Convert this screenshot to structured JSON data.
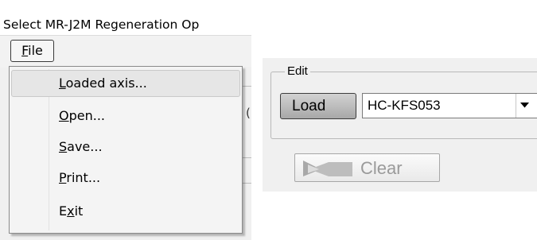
{
  "window": {
    "title": "Select MR-J2M Regeneration Op"
  },
  "menubar": {
    "file_label_accel": "F",
    "file_label_rest": "ile"
  },
  "file_menu": {
    "items": [
      {
        "accel": "L",
        "rest": "oaded axis...",
        "highlighted": true
      },
      {
        "accel": "O",
        "rest": "pen...",
        "highlighted": false
      },
      {
        "accel": "S",
        "rest": "ave...",
        "highlighted": false
      },
      {
        "accel": "P",
        "rest": "rint...",
        "highlighted": false
      },
      {
        "pre": "E",
        "accel": "x",
        "rest": "it",
        "highlighted": false
      }
    ]
  },
  "edit_group": {
    "title": "Edit",
    "load_label": "Load",
    "model_value": "HC-KFS053",
    "clear_label": "Clear"
  },
  "icons": {
    "combo_arrow": "chevron-down-icon",
    "clear_icon": "eraser-icon"
  },
  "colors": {
    "window_bg": "#f0f0f0",
    "menu_bg": "#f4f4f4",
    "highlight_bg": "#e6e6e6",
    "disabled_text": "#9a9a9a"
  }
}
